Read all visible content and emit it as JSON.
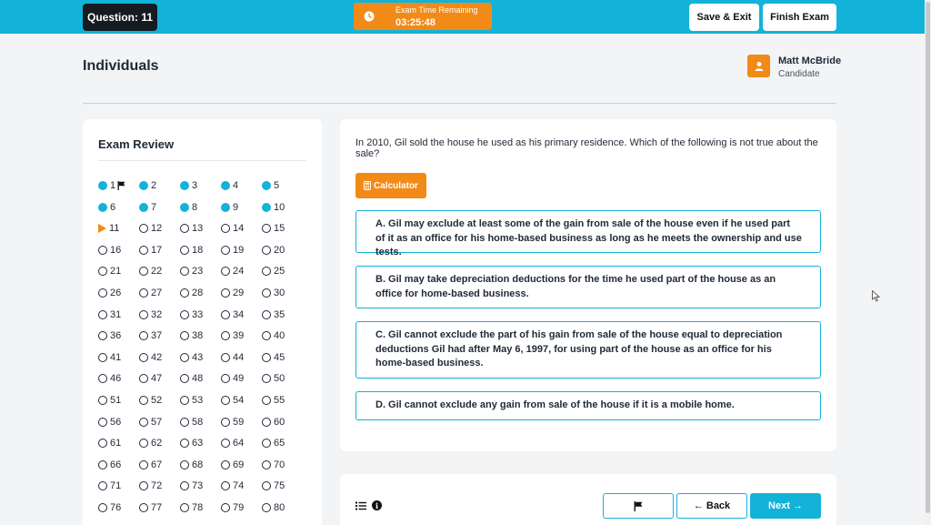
{
  "topbar": {
    "question_label": "Question: 11",
    "timer_label": "Exam Time Remaining",
    "timer_value": "03:25:48",
    "save_label": "Save & Exit",
    "finish_label": "Finish Exam"
  },
  "header": {
    "title": "Individuals",
    "user_name": "Matt McBride",
    "user_role": "Candidate"
  },
  "review": {
    "title": "Exam Review",
    "questions": [
      {
        "n": "1",
        "state": "answered",
        "flagged": true
      },
      {
        "n": "2",
        "state": "answered"
      },
      {
        "n": "3",
        "state": "answered"
      },
      {
        "n": "4",
        "state": "answered"
      },
      {
        "n": "5",
        "state": "answered"
      },
      {
        "n": "6",
        "state": "answered"
      },
      {
        "n": "7",
        "state": "answered"
      },
      {
        "n": "8",
        "state": "answered"
      },
      {
        "n": "9",
        "state": "answered"
      },
      {
        "n": "10",
        "state": "answered"
      },
      {
        "n": "11",
        "state": "current"
      },
      {
        "n": "12",
        "state": "empty"
      },
      {
        "n": "13",
        "state": "empty"
      },
      {
        "n": "14",
        "state": "empty"
      },
      {
        "n": "15",
        "state": "empty"
      },
      {
        "n": "16",
        "state": "empty"
      },
      {
        "n": "17",
        "state": "empty"
      },
      {
        "n": "18",
        "state": "empty"
      },
      {
        "n": "19",
        "state": "empty"
      },
      {
        "n": "20",
        "state": "empty"
      },
      {
        "n": "21",
        "state": "empty"
      },
      {
        "n": "22",
        "state": "empty"
      },
      {
        "n": "23",
        "state": "empty"
      },
      {
        "n": "24",
        "state": "empty"
      },
      {
        "n": "25",
        "state": "empty"
      },
      {
        "n": "26",
        "state": "empty"
      },
      {
        "n": "27",
        "state": "empty"
      },
      {
        "n": "28",
        "state": "empty"
      },
      {
        "n": "29",
        "state": "empty"
      },
      {
        "n": "30",
        "state": "empty"
      },
      {
        "n": "31",
        "state": "empty"
      },
      {
        "n": "32",
        "state": "empty"
      },
      {
        "n": "33",
        "state": "empty"
      },
      {
        "n": "34",
        "state": "empty"
      },
      {
        "n": "35",
        "state": "empty"
      },
      {
        "n": "36",
        "state": "empty"
      },
      {
        "n": "37",
        "state": "empty"
      },
      {
        "n": "38",
        "state": "empty"
      },
      {
        "n": "39",
        "state": "empty"
      },
      {
        "n": "40",
        "state": "empty"
      },
      {
        "n": "41",
        "state": "empty"
      },
      {
        "n": "42",
        "state": "empty"
      },
      {
        "n": "43",
        "state": "empty"
      },
      {
        "n": "44",
        "state": "empty"
      },
      {
        "n": "45",
        "state": "empty"
      },
      {
        "n": "46",
        "state": "empty"
      },
      {
        "n": "47",
        "state": "empty"
      },
      {
        "n": "48",
        "state": "empty"
      },
      {
        "n": "49",
        "state": "empty"
      },
      {
        "n": "50",
        "state": "empty"
      },
      {
        "n": "51",
        "state": "empty"
      },
      {
        "n": "52",
        "state": "empty"
      },
      {
        "n": "53",
        "state": "empty"
      },
      {
        "n": "54",
        "state": "empty"
      },
      {
        "n": "55",
        "state": "empty"
      },
      {
        "n": "56",
        "state": "empty"
      },
      {
        "n": "57",
        "state": "empty"
      },
      {
        "n": "58",
        "state": "empty"
      },
      {
        "n": "59",
        "state": "empty"
      },
      {
        "n": "60",
        "state": "empty"
      },
      {
        "n": "61",
        "state": "empty"
      },
      {
        "n": "62",
        "state": "empty"
      },
      {
        "n": "63",
        "state": "empty"
      },
      {
        "n": "64",
        "state": "empty"
      },
      {
        "n": "65",
        "state": "empty"
      },
      {
        "n": "66",
        "state": "empty"
      },
      {
        "n": "67",
        "state": "empty"
      },
      {
        "n": "68",
        "state": "empty"
      },
      {
        "n": "69",
        "state": "empty"
      },
      {
        "n": "70",
        "state": "empty"
      },
      {
        "n": "71",
        "state": "empty"
      },
      {
        "n": "72",
        "state": "empty"
      },
      {
        "n": "73",
        "state": "empty"
      },
      {
        "n": "74",
        "state": "empty"
      },
      {
        "n": "75",
        "state": "empty"
      },
      {
        "n": "76",
        "state": "empty"
      },
      {
        "n": "77",
        "state": "empty"
      },
      {
        "n": "78",
        "state": "empty"
      },
      {
        "n": "79",
        "state": "empty"
      },
      {
        "n": "80",
        "state": "empty"
      }
    ]
  },
  "question": {
    "text": "In 2010, Gil sold the house he used as his primary residence. Which of the following is not true about the sale?",
    "calculator_label": "Calculator",
    "options": [
      "A. Gil may exclude at least some of the gain from sale of the house even if he used part of it as an office for his home-based business as long as he meets the ownership and use tests.",
      "B. Gil may take depreciation deductions for the time he used part of the house as an office for home-based business.",
      "C. Gil cannot exclude the part of his gain from sale of the house equal to depreciation deductions Gil had after May 6, 1997, for using part of the house as an office for his home-based business.",
      "D. Gil cannot exclude any gain from sale of the house if it is a mobile home."
    ]
  },
  "nav": {
    "back_label": "← Back",
    "next_label": "Next →",
    "info_glyph": "i"
  },
  "colors": {
    "accent": "#13b2d9",
    "orange": "#f28a17",
    "dark": "#161b22"
  },
  "icons": {
    "timer": "clock-icon",
    "user": "user-icon",
    "calculator": "calculator-icon",
    "flag": "flag-icon",
    "list": "list-icon",
    "info": "info-icon"
  }
}
